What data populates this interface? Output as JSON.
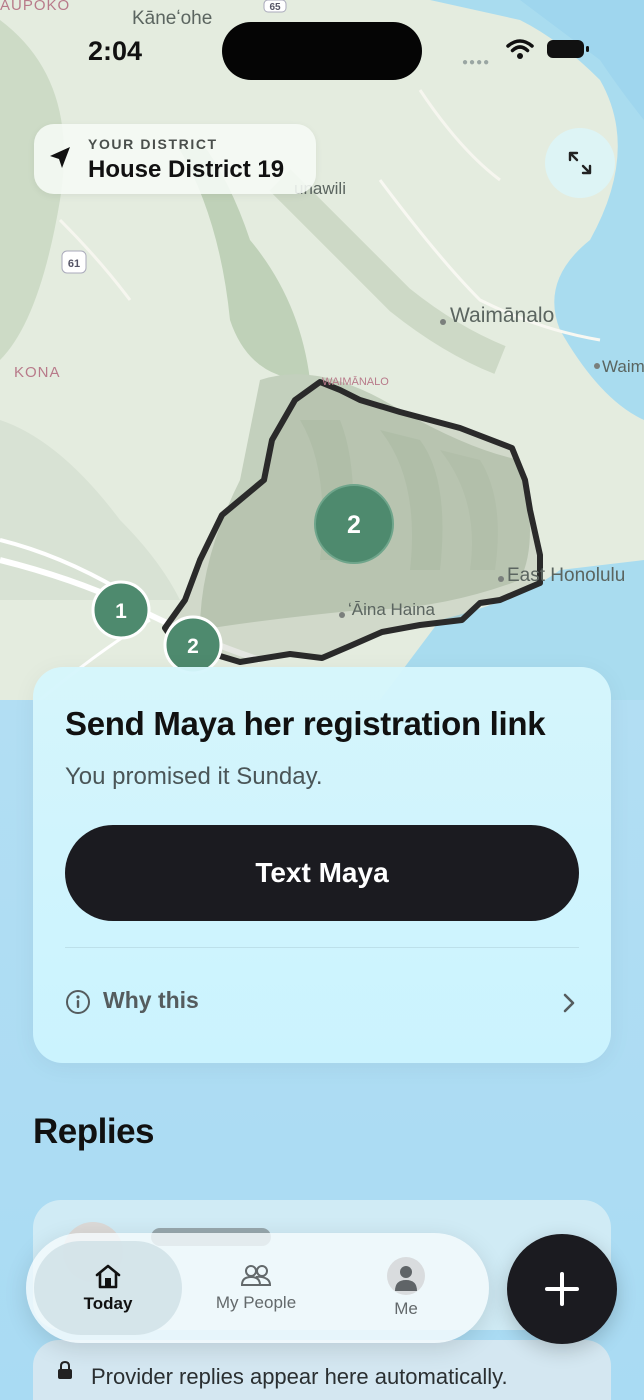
{
  "status_bar": {
    "time": "2:04"
  },
  "map": {
    "place_labels": {
      "kaneohe": "Kāneʻohe",
      "kaupoko": "AUPOKO",
      "kona": "KONA",
      "waimanalo": "Waimānalo",
      "waimanalo_small": "WAIMĀNALO",
      "waim_edge": "Waim",
      "east_honolulu": "East Honolulu",
      "aina_haina": "ʻĀina Haina",
      "unawili": "unawili",
      "route_61": "61",
      "route_65": "65"
    },
    "clusters": [
      {
        "label": "2"
      },
      {
        "label": "1"
      },
      {
        "label": "2"
      }
    ]
  },
  "district_chip": {
    "eyebrow": "YOUR DISTRICT",
    "name": "House District 19"
  },
  "action_card": {
    "title": "Send Maya her registration link",
    "subtitle": "You promised it Sunday.",
    "cta_label": "Text Maya",
    "why_label": "Why this"
  },
  "replies": {
    "heading": "Replies",
    "notice": "Provider replies appear here automatically."
  },
  "tabbar": {
    "tabs": [
      {
        "label": "Today",
        "icon": "house-icon",
        "active": true
      },
      {
        "label": "My People",
        "icon": "people-icon",
        "active": false
      },
      {
        "label": "Me",
        "icon": "person-icon",
        "active": false
      }
    ]
  },
  "fab": {
    "icon": "plus-icon"
  },
  "colors": {
    "cluster_green": "#4e8a6e",
    "cta_dark": "#1b1b20",
    "district_outline": "#2a2a2a"
  }
}
